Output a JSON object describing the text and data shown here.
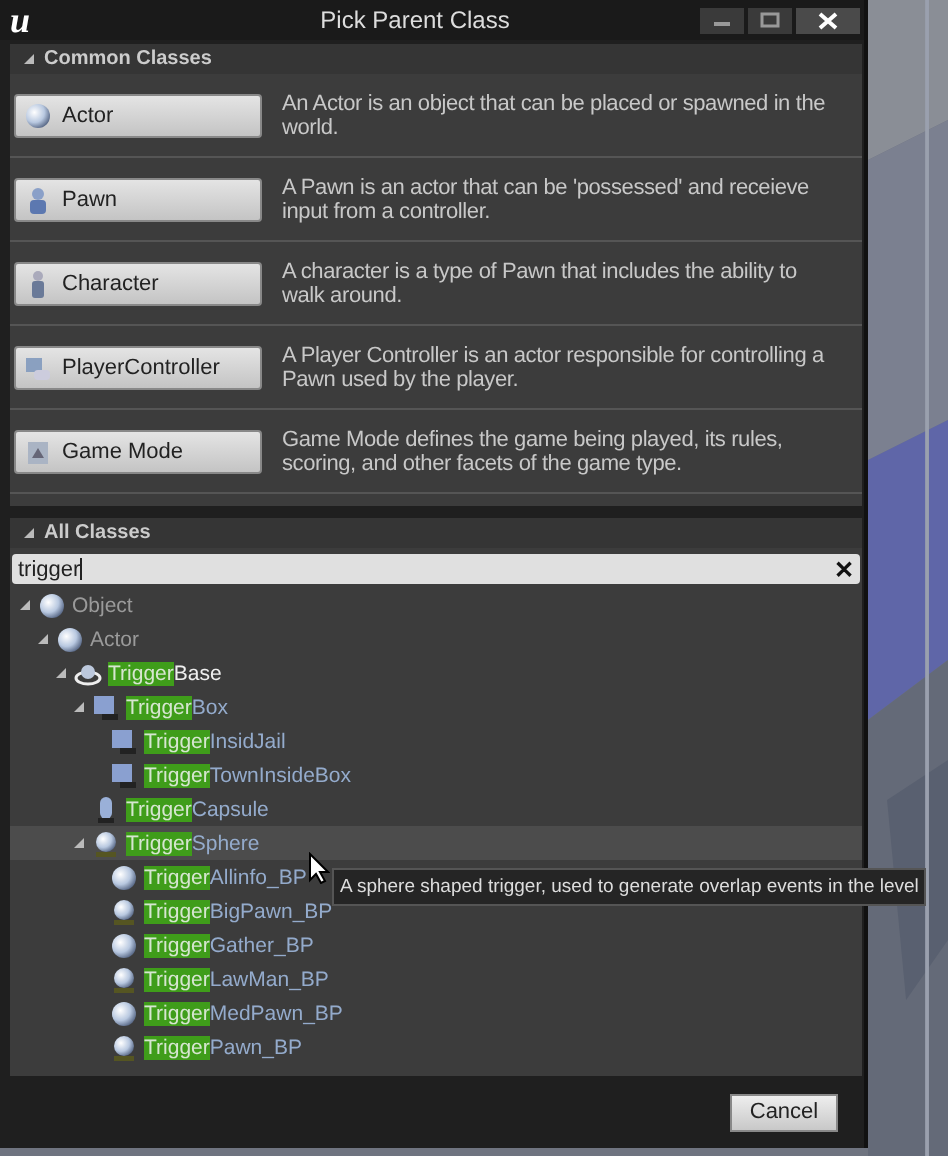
{
  "window": {
    "logo": "u",
    "title": "Pick Parent Class"
  },
  "common_classes": {
    "header": "Common Classes",
    "expanded": true,
    "items": [
      {
        "kind": "sphere",
        "label": "Actor",
        "description": "An Actor is an object that can be placed or spawned in the world."
      },
      {
        "kind": "pawn",
        "label": "Pawn",
        "description": "A Pawn is an actor that can be 'possessed' and receieve input from a controller."
      },
      {
        "kind": "character",
        "label": "Character",
        "description": "A character is a type of Pawn that includes the ability to walk around."
      },
      {
        "kind": "controller",
        "label": "PlayerController",
        "description": "A Player Controller is an actor responsible for controlling a Pawn used by the player."
      },
      {
        "kind": "gamemode",
        "label": "Game Mode",
        "description": "Game Mode defines the game being played, its rules, scoring, and other facets of the game type."
      }
    ]
  },
  "all_classes": {
    "header": "All Classes",
    "expanded": true,
    "search": {
      "value": "trigger",
      "clear": "✕"
    },
    "tree": [
      {
        "kind": "sphere",
        "label": "Object",
        "dimmed": true,
        "blueprint": false,
        "hovered": false,
        "expanded": true,
        "children": [
          {
            "kind": "sphere",
            "label": "Actor",
            "dimmed": true,
            "blueprint": false,
            "hovered": false,
            "expanded": true,
            "children": [
              {
                "kind": "ring",
                "match": "Trigger",
                "rest": "Base",
                "dimmed": false,
                "blueprint": false,
                "hovered": false,
                "expanded": true,
                "children": [
                  {
                    "kind": "box",
                    "match": "Trigger",
                    "rest": "Box",
                    "dimmed": false,
                    "blueprint": true,
                    "hovered": false,
                    "expanded": true,
                    "children": [
                      {
                        "kind": "box",
                        "match": "Trigger",
                        "rest": "InsidJail",
                        "dimmed": false,
                        "blueprint": true,
                        "hovered": false
                      },
                      {
                        "kind": "box",
                        "match": "Trigger",
                        "rest": "TownInsideBox",
                        "dimmed": false,
                        "blueprint": true,
                        "hovered": false
                      }
                    ]
                  },
                  {
                    "kind": "capsule",
                    "match": "Trigger",
                    "rest": "Capsule",
                    "dimmed": false,
                    "blueprint": true,
                    "hovered": false
                  },
                  {
                    "kind": "bust",
                    "match": "Trigger",
                    "rest": "Sphere",
                    "dimmed": false,
                    "blueprint": true,
                    "hovered": true,
                    "expanded": true,
                    "children": [
                      {
                        "kind": "sphere",
                        "match": "Trigger",
                        "rest": "Allinfo_BP",
                        "dimmed": false,
                        "blueprint": true,
                        "hovered": false
                      },
                      {
                        "kind": "bust",
                        "match": "Trigger",
                        "rest": "BigPawn_BP",
                        "dimmed": false,
                        "blueprint": true,
                        "hovered": false
                      },
                      {
                        "kind": "sphere",
                        "match": "Trigger",
                        "rest": "Gather_BP",
                        "dimmed": false,
                        "blueprint": true,
                        "hovered": false
                      },
                      {
                        "kind": "bust",
                        "match": "Trigger",
                        "rest": "LawMan_BP",
                        "dimmed": false,
                        "blueprint": true,
                        "hovered": false
                      },
                      {
                        "kind": "sphere",
                        "match": "Trigger",
                        "rest": "MedPawn_BP",
                        "dimmed": false,
                        "blueprint": true,
                        "hovered": false
                      },
                      {
                        "kind": "bust",
                        "match": "Trigger",
                        "rest": "Pawn_BP",
                        "dimmed": false,
                        "blueprint": true,
                        "hovered": false
                      }
                    ]
                  }
                ]
              }
            ]
          }
        ]
      }
    ]
  },
  "tooltip": "A sphere shaped trigger, used to generate overlap events in the level",
  "buttons": [
    "Cancel"
  ]
}
